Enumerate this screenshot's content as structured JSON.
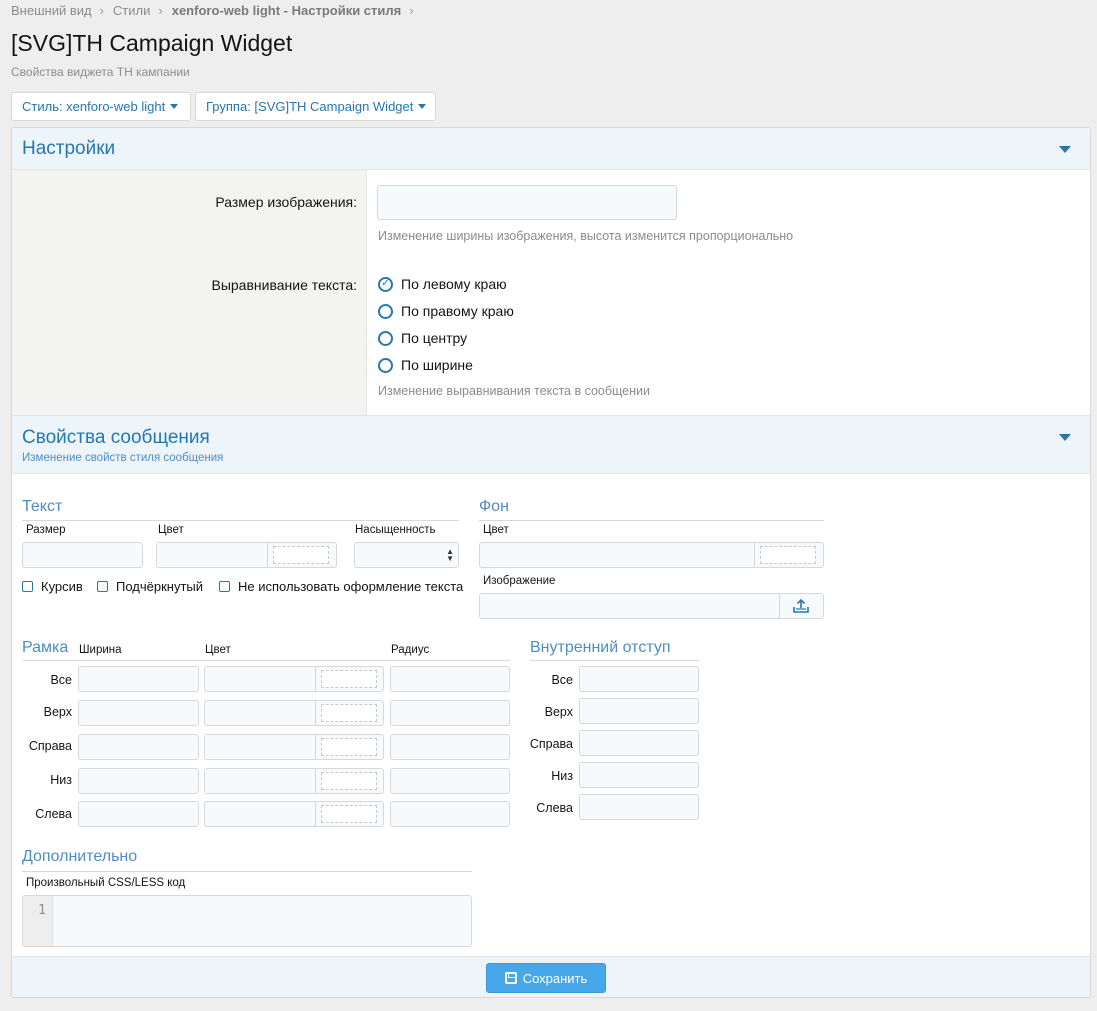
{
  "breadcrumb": [
    {
      "label": "Внешний вид"
    },
    {
      "label": "Стили"
    },
    {
      "label": "xenforo-web light - Настройки стиля"
    }
  ],
  "page": {
    "title": "[SVG]TH Campaign Widget",
    "description": "Свойства виджета TH кампании"
  },
  "filters": {
    "style_label": "Стиль: xenforo-web light",
    "group_label": "Группа: [SVG]TH Campaign Widget"
  },
  "settings": {
    "title": "Настройки",
    "image_size": {
      "label": "Размер изображения:",
      "value": "",
      "hint": "Изменение ширины изображения, высота изменится пропорционально"
    },
    "text_align": {
      "label": "Выравнивание текста:",
      "options": [
        {
          "label": "По левому краю",
          "checked": true
        },
        {
          "label": "По правому краю",
          "checked": false
        },
        {
          "label": "По центру",
          "checked": false
        },
        {
          "label": "По ширине",
          "checked": false
        }
      ],
      "hint": "Изменение выравнивания текста в сообщении"
    }
  },
  "message_props": {
    "title": "Свойства сообщения",
    "subtitle": "Изменение свойств стиля сообщения",
    "text": {
      "title": "Текст",
      "size_label": "Размер",
      "color_label": "Цвет",
      "weight_label": "Насыщенность",
      "italic_label": "Курсив",
      "underline_label": "Подчёркнутый",
      "no_decoration_label": "Не использовать оформление текста"
    },
    "background": {
      "title": "Фон",
      "color_label": "Цвет",
      "image_label": "Изображение"
    },
    "border": {
      "title": "Рамка",
      "width_label": "Ширина",
      "color_label": "Цвет",
      "radius_label": "Радиус",
      "rows": [
        "Все",
        "Верх",
        "Справа",
        "Низ",
        "Слева"
      ]
    },
    "padding": {
      "title": "Внутренний отступ",
      "rows": [
        "Все",
        "Верх",
        "Справа",
        "Низ",
        "Слева"
      ]
    },
    "extra": {
      "title": "Дополнительно",
      "css_label": "Произвольный CSS/LESS код",
      "line_number": "1",
      "code": ""
    }
  },
  "footer": {
    "save_label": "Сохранить"
  },
  "colors": {
    "accent": "#2577b1",
    "header_bg": "#edf5fb",
    "button_bg": "#47a7eb"
  }
}
